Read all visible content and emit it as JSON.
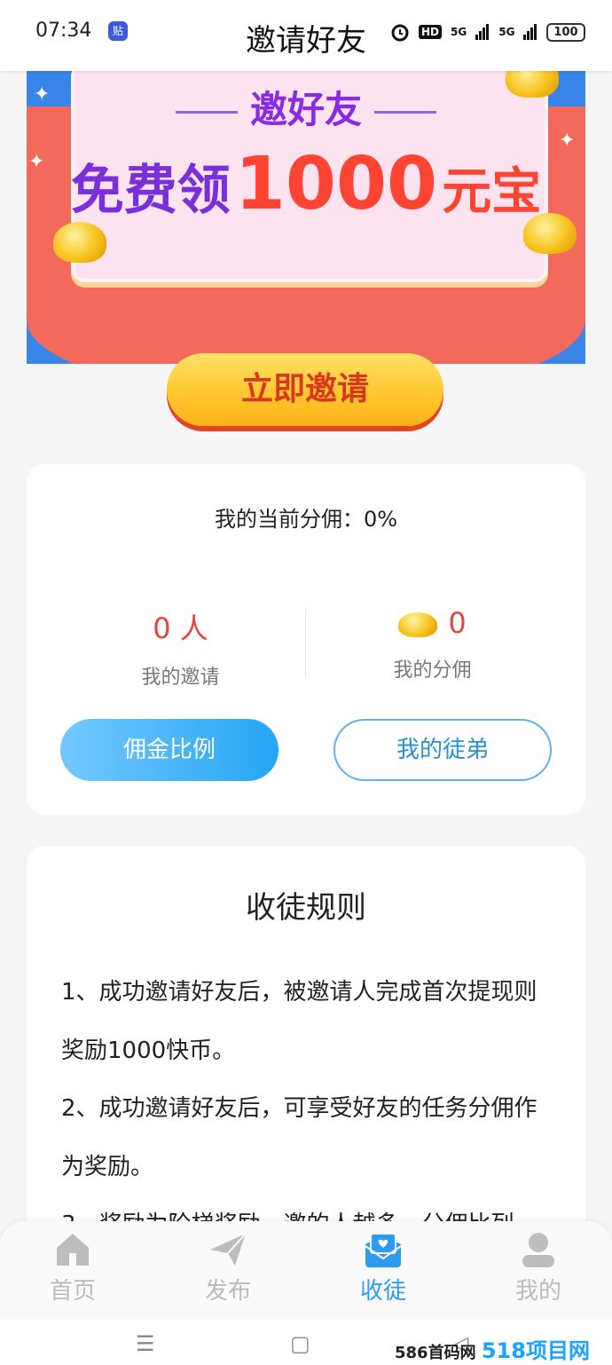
{
  "status_bar": {
    "time": "07:34",
    "badge": "贴",
    "hd": "HD",
    "net1": "5G",
    "net2": "5G",
    "battery": "100"
  },
  "header": {
    "title": "邀请好友"
  },
  "banner": {
    "subtitle": "邀好友",
    "main_prefix": "免费领",
    "main_number": "1000",
    "main_suffix": "元宝"
  },
  "invite_button": {
    "label": "立即邀请"
  },
  "stats": {
    "commission_label": "我的当前分佣：0%",
    "invites_value": "0 人",
    "invites_label": "我的邀请",
    "commission_value": "0",
    "commission_stat_label": "我的分佣",
    "ratio_button": "佣金比例",
    "disciples_button": "我的徒弟"
  },
  "rules": {
    "title": "收徒规则",
    "items": [
      "1、成功邀请好友后，被邀请人完成首次提现则奖励1000快币。",
      "2、成功邀请好友后，可享受好友的任务分佣作为奖励。",
      "3、奖励为阶梯奖励，邀的人越多，分佣比列"
    ]
  },
  "nav": {
    "items": [
      {
        "label": "首页",
        "icon": "home-icon"
      },
      {
        "label": "发布",
        "icon": "paper-plane-icon"
      },
      {
        "label": "收徒",
        "icon": "heart-envelope-icon",
        "active": true
      },
      {
        "label": "我的",
        "icon": "user-icon"
      }
    ]
  },
  "system_nav": {
    "menu": "☰",
    "home": "▢",
    "back": "◁"
  },
  "watermark": {
    "text": "586首码网",
    "brand": "518项目网"
  },
  "colors": {
    "accent": "#2d9bef",
    "red": "#e4463c",
    "gold": "#ffc52b"
  }
}
